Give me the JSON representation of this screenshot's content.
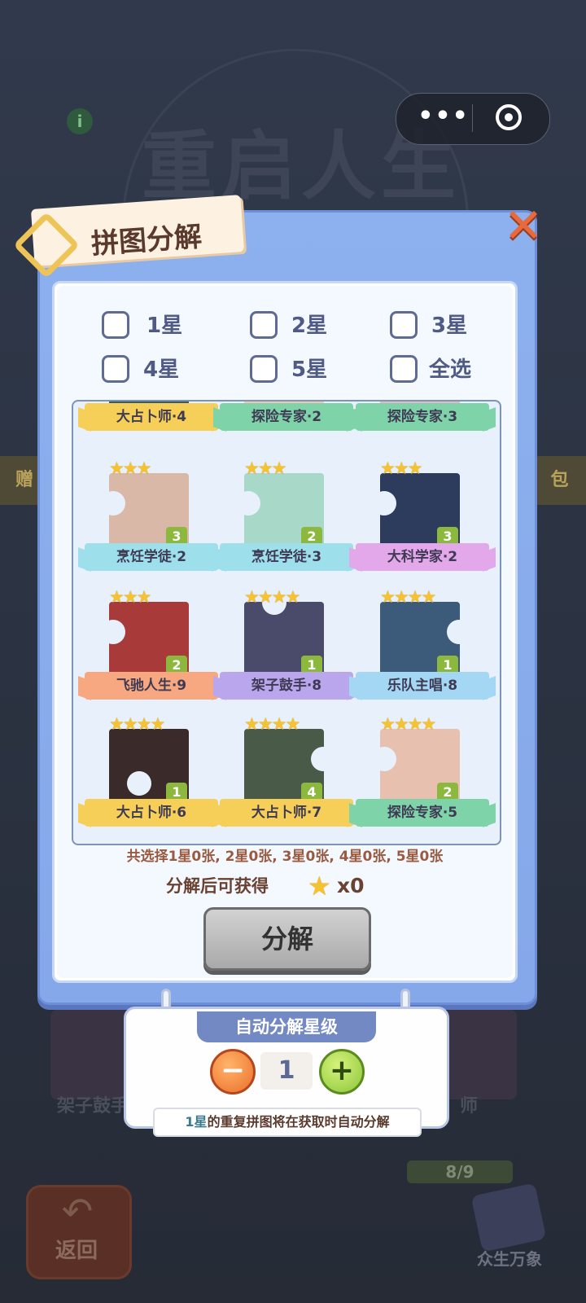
{
  "background": {
    "game_title": "重启人生",
    "gift_left": "赠",
    "gift_right": "包",
    "back_label": "返回",
    "book_label": "众生万象",
    "card_left_label": "架子鼓手",
    "card_right_label": "师",
    "progress": "8/9"
  },
  "capsule": {
    "more_icon": "•••"
  },
  "modal": {
    "title": "拼图分解",
    "close_icon": "✕",
    "filters": [
      {
        "label": "1星"
      },
      {
        "label": "2星"
      },
      {
        "label": "3星"
      },
      {
        "label": "4星"
      },
      {
        "label": "5星"
      },
      {
        "label": "全选"
      }
    ],
    "pieces": [
      {
        "name": "大占卜师·4",
        "stars": "",
        "count": "",
        "ribbon_color": "#f5cf58",
        "img_color": "#3c5a58"
      },
      {
        "name": "探险专家·2",
        "stars": "",
        "count": "",
        "ribbon_color": "#7fd3a8",
        "img_color": "#f2c7b8"
      },
      {
        "name": "探险专家·3",
        "stars": "",
        "count": "",
        "ribbon_color": "#7fd3a8",
        "img_color": "#e6b9c6"
      },
      {
        "name": "烹饪学徒·2",
        "stars": "★★★",
        "count": "3",
        "ribbon_color": "#9de0ec",
        "img_color": "#d9b8a8"
      },
      {
        "name": "烹饪学徒·3",
        "stars": "★★★",
        "count": "2",
        "ribbon_color": "#9de0ec",
        "img_color": "#a8d8c8"
      },
      {
        "name": "大科学家·2",
        "stars": "★★★",
        "count": "3",
        "ribbon_color": "#e3a8ea",
        "img_color": "#2d3b5c"
      },
      {
        "name": "飞驰人生·9",
        "stars": "★★★",
        "count": "2",
        "ribbon_color": "#f7a880",
        "img_color": "#a83a3a"
      },
      {
        "name": "架子鼓手·8",
        "stars": "★★★★",
        "count": "1",
        "ribbon_color": "#b9a6ec",
        "img_color": "#4a4a6a"
      },
      {
        "name": "乐队主唱·8",
        "stars": "★★★★",
        "count": "1",
        "ribbon_color": "#a3d7f3",
        "img_color": "#3c5a7a"
      },
      {
        "name": "大占卜师·6",
        "stars": "★★★★",
        "count": "1",
        "ribbon_color": "#f5cf58",
        "img_color": "#3a2a2a"
      },
      {
        "name": "大占卜师·7",
        "stars": "★★★★",
        "count": "4",
        "ribbon_color": "#f5cf58",
        "img_color": "#4a5a48"
      },
      {
        "name": "探险专家·5",
        "stars": "★★★★",
        "count": "2",
        "ribbon_color": "#7fd3a8",
        "img_color": "#e8c0b0"
      }
    ],
    "summary": "共选择1星0张, 2星0张, 3星0张, 4星0张, 5星0张",
    "gain_label": "分解后可获得",
    "gain_star": "★",
    "gain_value": "x0",
    "decompose_button": "分解"
  },
  "auto_decompose": {
    "title": "自动分解星级",
    "minus": "−",
    "plus": "+",
    "value": "1",
    "tip_highlight": "1星",
    "tip_rest": "的重复拼图将在获取时自动分解"
  }
}
